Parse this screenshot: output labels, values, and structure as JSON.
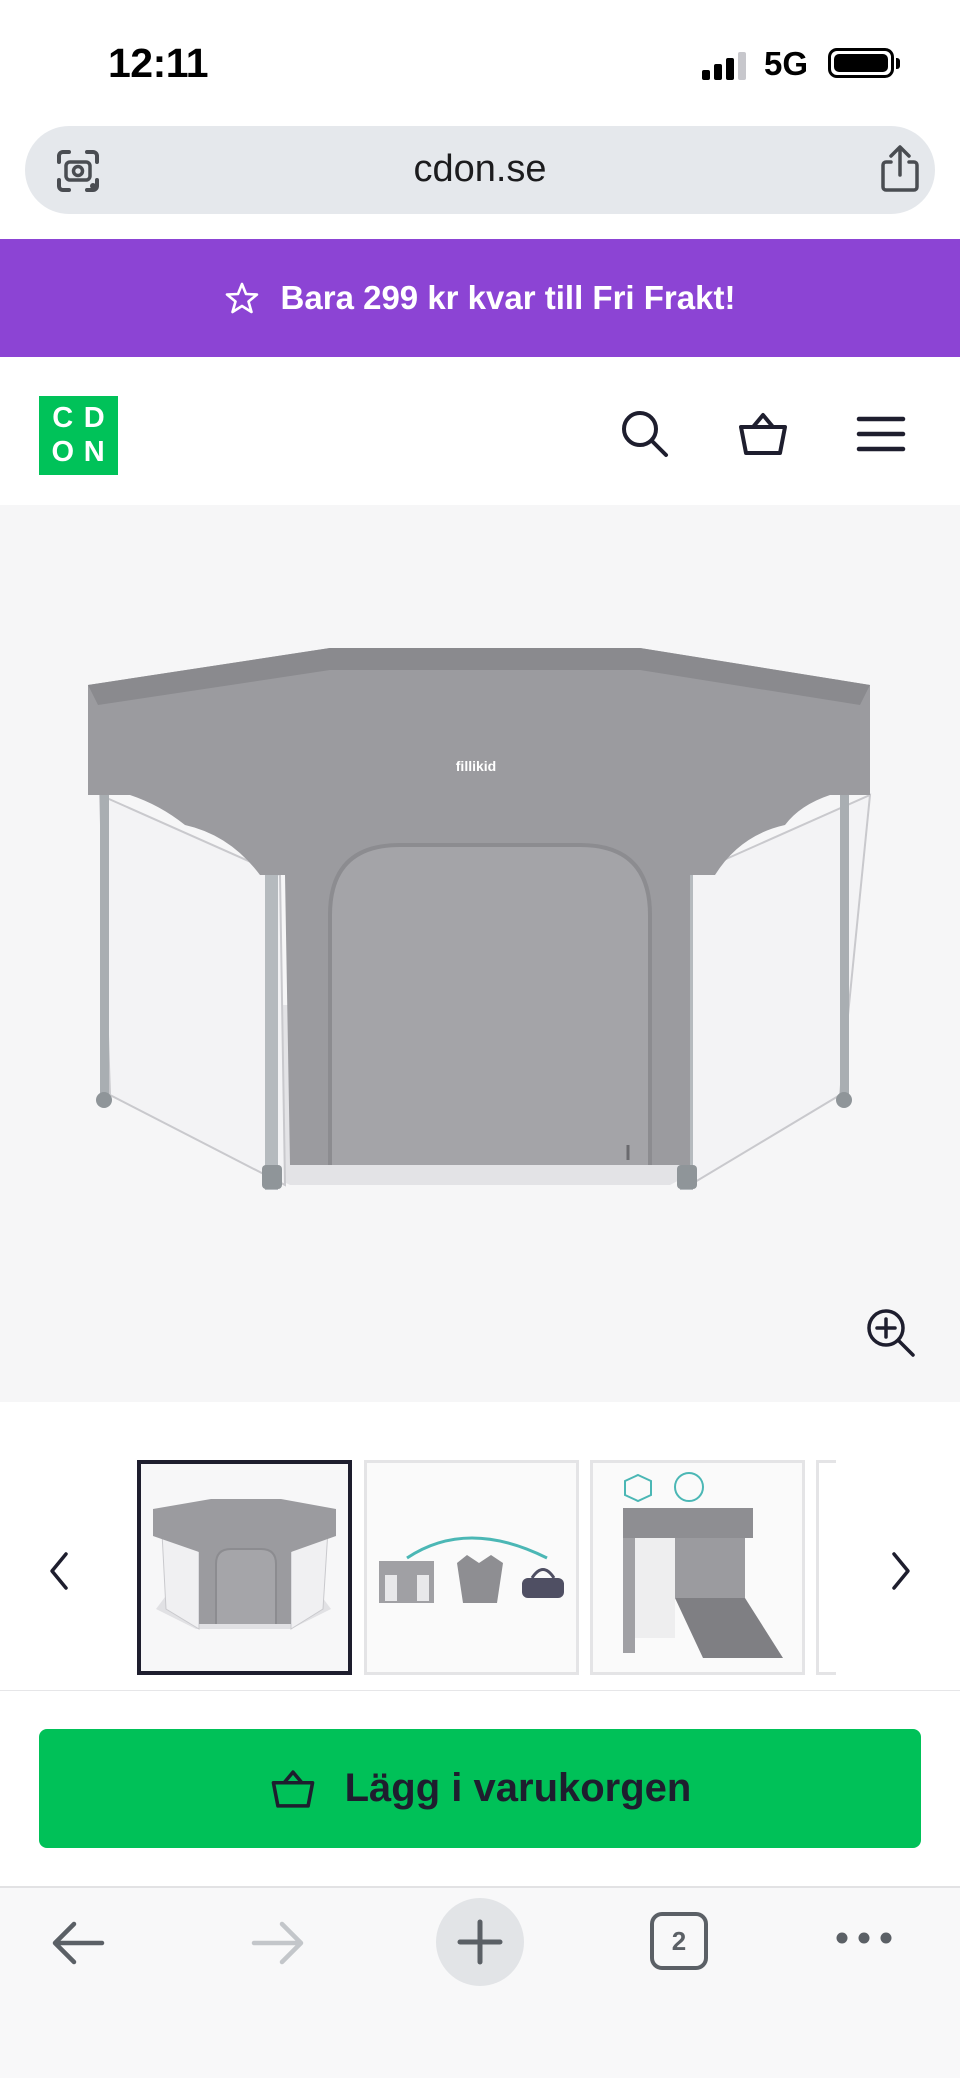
{
  "status_bar": {
    "time": "12:11",
    "network": "5G",
    "signal_bars": 3,
    "battery_level": 1.0
  },
  "browser": {
    "url": "cdon.se",
    "open_tabs": "2"
  },
  "promo_banner": {
    "text": "Bara 299 kr kvar till Fri Frakt!",
    "icon": "star-icon"
  },
  "header": {
    "logo_letters": [
      "C",
      "D",
      "O",
      "N"
    ],
    "icons": [
      "search-icon",
      "basket-icon",
      "menu-icon"
    ]
  },
  "product": {
    "brand_print": "fillikid",
    "image_count_visible": 4,
    "selected_image": 1
  },
  "cta": {
    "label": "Lägg i varukorgen",
    "icon": "basket-icon"
  },
  "colors": {
    "promo": "#8c44d4",
    "brand_green": "#00c259",
    "cta_green": "#00c158",
    "dark": "#1e1e2e"
  }
}
